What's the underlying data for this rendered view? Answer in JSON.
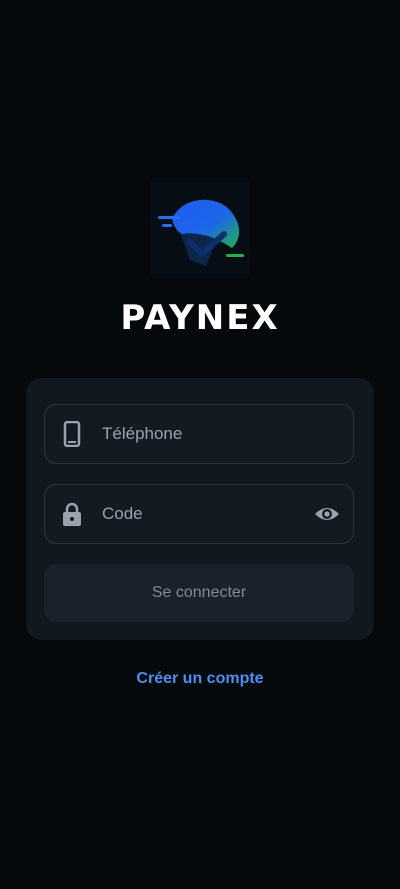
{
  "brand": {
    "name": "PAYNEX"
  },
  "form": {
    "phone": {
      "placeholder": "Téléphone",
      "icon": "phone-icon"
    },
    "code": {
      "placeholder": "Code",
      "icon": "lock-icon",
      "toggle_icon": "eye-icon"
    },
    "submit_label": "Se connecter"
  },
  "links": {
    "create_account": "Créer un compte"
  },
  "colors": {
    "background": "#05090c",
    "card": "#11181f",
    "accent_link": "#4f8df5",
    "logo_blue": "#1f5df0",
    "logo_green": "#1fb44b"
  }
}
